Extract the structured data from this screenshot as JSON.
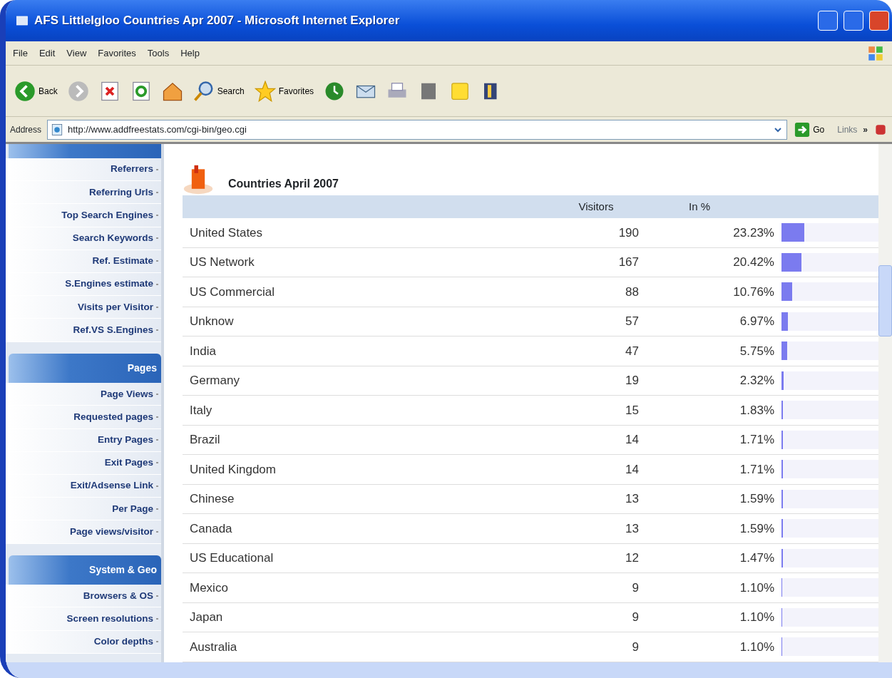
{
  "window": {
    "title": "AFS LittleIgloo Countries Apr 2007 - Microsoft Internet Explorer"
  },
  "menu": [
    "File",
    "Edit",
    "View",
    "Favorites",
    "Tools",
    "Help"
  ],
  "toolbar": [
    {
      "kind": "back",
      "label": "Back"
    },
    {
      "kind": "forward"
    },
    {
      "kind": "stop"
    },
    {
      "kind": "refresh"
    },
    {
      "kind": "home"
    },
    {
      "kind": "search",
      "label": "Search"
    },
    {
      "kind": "favorites",
      "label": "Favorites"
    },
    {
      "kind": "history"
    },
    {
      "kind": "mail"
    },
    {
      "kind": "print"
    },
    {
      "kind": "edit"
    },
    {
      "kind": "note"
    },
    {
      "kind": "research"
    }
  ],
  "address_bar": {
    "label": "Address",
    "value": "http://www.addfreestats.com/cgi-bin/geo.cgi",
    "go": "Go",
    "links": "Links",
    "more": "»"
  },
  "sidebar": [
    {
      "items": [
        "Referrers",
        "Referring Urls",
        "Top Search Engines",
        "Search Keywords",
        "Ref. Estimate",
        "S.Engines estimate",
        "Visits per Visitor",
        "Ref.VS S.Engines"
      ]
    },
    {
      "header": "Pages",
      "items": [
        "Page Views",
        "Requested pages",
        "Entry Pages",
        "Exit Pages",
        "Exit/Adsense Link",
        "Per Page",
        "Page views/visitor"
      ]
    },
    {
      "header": "System & Geo",
      "items": [
        "Browsers & OS",
        "Screen resolutions",
        "Color depths"
      ]
    }
  ],
  "content": {
    "title": "Countries April 2007",
    "columns": [
      "Visitors",
      "In %"
    ],
    "rows": [
      {
        "country": "United States",
        "visitors": "190",
        "percent": "23.23%",
        "level": 0.2323
      },
      {
        "country": "US Network",
        "visitors": "167",
        "percent": "20.42%",
        "level": 0.2042
      },
      {
        "country": "US Commercial",
        "visitors": "88",
        "percent": "10.76%",
        "level": 0.1076
      },
      {
        "country": "Unknow",
        "visitors": "57",
        "percent": "6.97%",
        "level": 0.0697
      },
      {
        "country": "India",
        "visitors": "47",
        "percent": "5.75%",
        "level": 0.0575
      },
      {
        "country": "Germany",
        "visitors": "19",
        "percent": "2.32%",
        "level": 0.0232
      },
      {
        "country": "Italy",
        "visitors": "15",
        "percent": "1.83%",
        "level": 0.0183
      },
      {
        "country": "Brazil",
        "visitors": "14",
        "percent": "1.71%",
        "level": 0.0171
      },
      {
        "country": "United Kingdom",
        "visitors": "14",
        "percent": "1.71%",
        "level": 0.0171
      },
      {
        "country": "Chinese",
        "visitors": "13",
        "percent": "1.59%",
        "level": 0.0159
      },
      {
        "country": "Canada",
        "visitors": "13",
        "percent": "1.59%",
        "level": 0.0159
      },
      {
        "country": "US Educational",
        "visitors": "12",
        "percent": "1.47%",
        "level": 0.0147
      },
      {
        "country": "Mexico",
        "visitors": "9",
        "percent": "1.10%",
        "level": 0.011
      },
      {
        "country": "Japan",
        "visitors": "9",
        "percent": "1.10%",
        "level": 0.011
      },
      {
        "country": "Australia",
        "visitors": "9",
        "percent": "1.10%",
        "level": 0.011
      }
    ]
  }
}
